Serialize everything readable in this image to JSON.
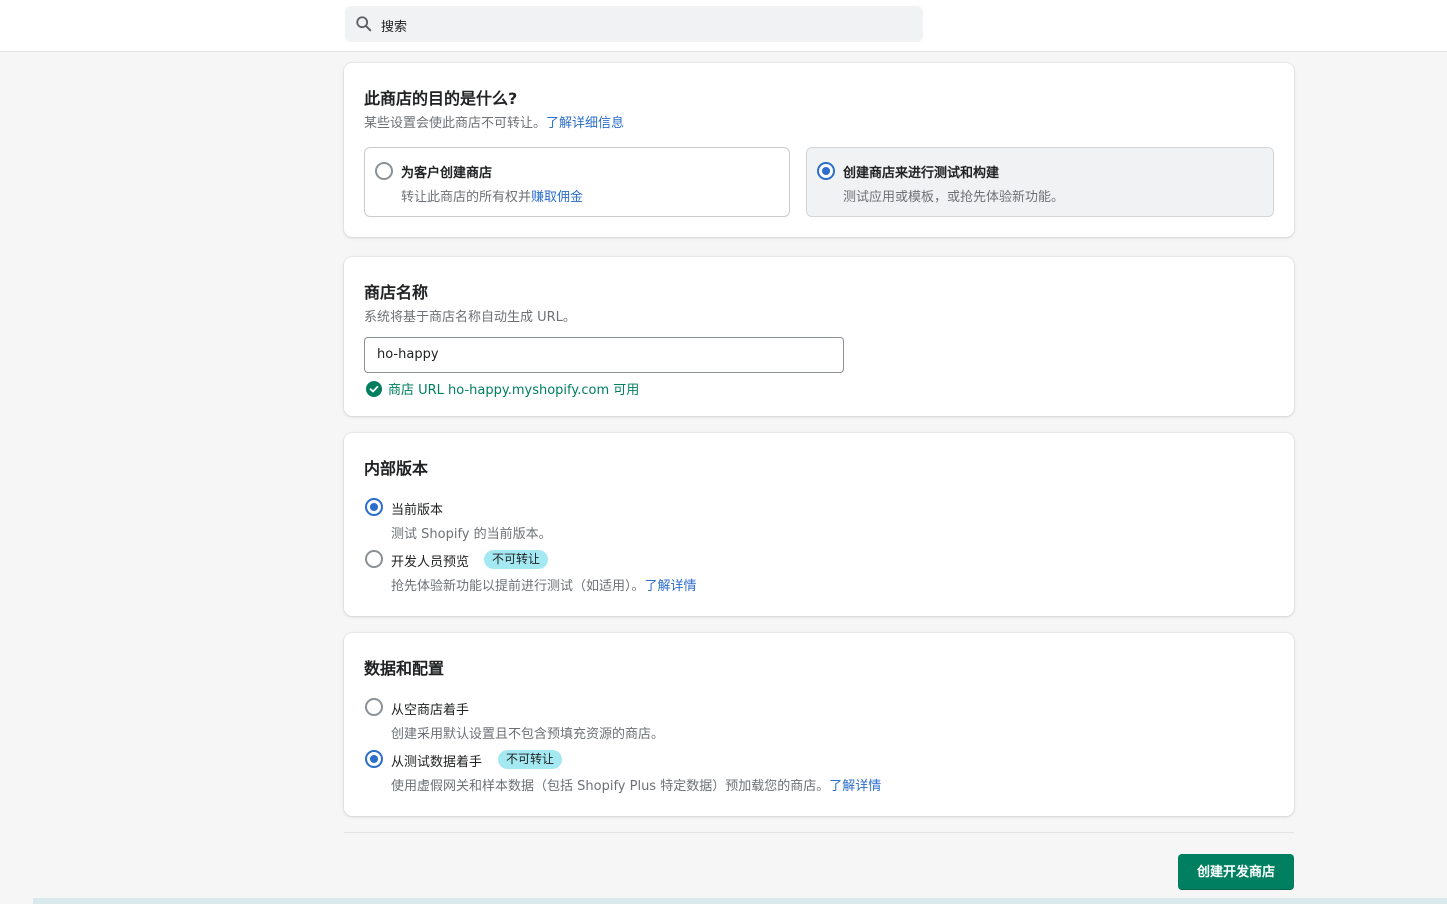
{
  "search": {
    "placeholder": "搜索"
  },
  "purpose": {
    "title": "此商店的目的是什么?",
    "subtitle": "某些设置会使此商店不可转让。",
    "subtitle_link": "了解详细信息",
    "options": [
      {
        "title": "为客户创建商店",
        "desc": "转让此商店的所有权并",
        "desc_link": "赚取佣金",
        "selected": false
      },
      {
        "title": "创建商店来进行测试和构建",
        "desc": "测试应用或模板，或抢先体验新功能。",
        "selected": true
      }
    ]
  },
  "store_name": {
    "title": "商店名称",
    "subtitle": "系统将基于商店名称自动生成 URL。",
    "value": "ho-happy",
    "success": "商店 URL ho-happy.myshopify.com 可用"
  },
  "build": {
    "title": "内部版本",
    "options": [
      {
        "label": "当前版本",
        "desc": "测试 Shopify 的当前版本。",
        "selected": true
      },
      {
        "label": "开发人员预览",
        "badge": "不可转让",
        "desc": "抢先体验新功能以提前进行测试（如适用）。",
        "desc_link": "了解详情",
        "selected": false
      }
    ]
  },
  "data_config": {
    "title": "数据和配置",
    "options": [
      {
        "label": "从空商店着手",
        "desc": "创建采用默认设置且不包含预填充资源的商店。",
        "selected": false
      },
      {
        "label": "从测试数据着手",
        "badge": "不可转让",
        "desc": "使用虚假网关和样本数据（包括 Shopify Plus 特定数据）预加载您的商店。",
        "desc_link": "了解详情",
        "selected": true
      }
    ]
  },
  "actions": {
    "create_label": "创建开发商店"
  },
  "colors": {
    "primary": "#008060",
    "link": "#2c6ecb",
    "success": "#007f5f",
    "badge": "#a4e8f2"
  },
  "icons": {
    "search": "search-icon",
    "success": "check-circle-icon"
  }
}
